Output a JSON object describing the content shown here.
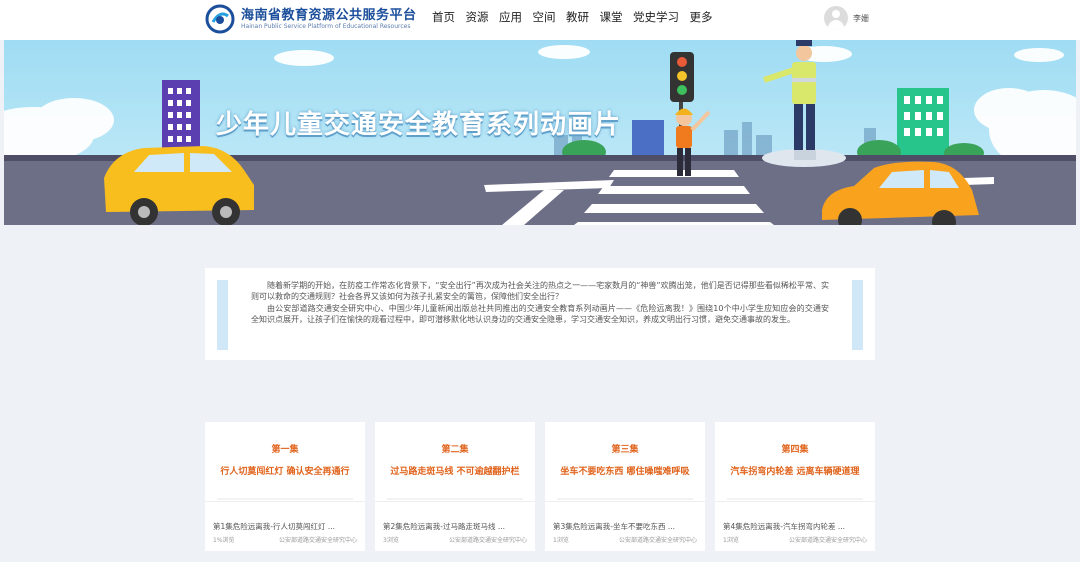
{
  "header": {
    "logo_cn": "海南省教育资源公共服务平台",
    "logo_en": "Hainan Public Service Platform of Educational Resources",
    "nav": [
      "首页",
      "资源",
      "应用",
      "空间",
      "教研",
      "课堂",
      "党史学习",
      "更多"
    ],
    "user_name": "李姗"
  },
  "banner": {
    "title": "少年儿童交通安全教育系列动画片"
  },
  "intro": {
    "paragraph_1": "随着新学期的开始，在防疫工作常态化背景下，“安全出行”再次成为社会关注的热点之一——宅家数月的“神兽”欢腾出笼，他们是否记得那些看似稀松平常、实则可以救命的交通规则？社会各界又该如何为孩子扎紧安全的篱笆，保障他们安全出行？",
    "paragraph_2": "由公安部道路交通安全研究中心、中国少年儿童新闻出版总社共同推出的交通安全教育系列动画片——《危险远离我！》围绕10个中小学生应知应会的交通安全知识点展开，让孩子们在愉快的观看过程中，即可潜移默化地认识身边的交通安全隐患，学习交通安全知识，养成文明出行习惯，避免交通事故的发生。"
  },
  "cards": [
    {
      "episode": "第一集",
      "slogan": "行人切莫闯红灯  确认安全再通行",
      "title": "第1集危险远离我-行人切莫闯红灯 ...",
      "views": "1%浏览",
      "source": "公安部道路交通安全研究中心"
    },
    {
      "episode": "第二集",
      "slogan": "过马路走斑马线  不可逾越翻护栏",
      "title": "第2集危险远离我-过马路走斑马线 ...",
      "views": "3浏览",
      "source": "公安部道路交通安全研究中心"
    },
    {
      "episode": "第三集",
      "slogan": "坐车不要吃东西  哪住噪嗤难呼吸",
      "title": "第3集危险远离我-坐车不要吃东西 ...",
      "views": "1浏览",
      "source": "公安部道路交通安全研究中心"
    },
    {
      "episode": "第四集",
      "slogan": "汽车拐弯内轮差  远离车辆硬道理",
      "title": "第4集危险远离我-汽车拐弯内轮差 ...",
      "views": "1浏览",
      "source": "公安部道路交通安全研究中心"
    }
  ],
  "colors": {
    "accent": "#e0641d",
    "brand": "#1b4e9b"
  }
}
